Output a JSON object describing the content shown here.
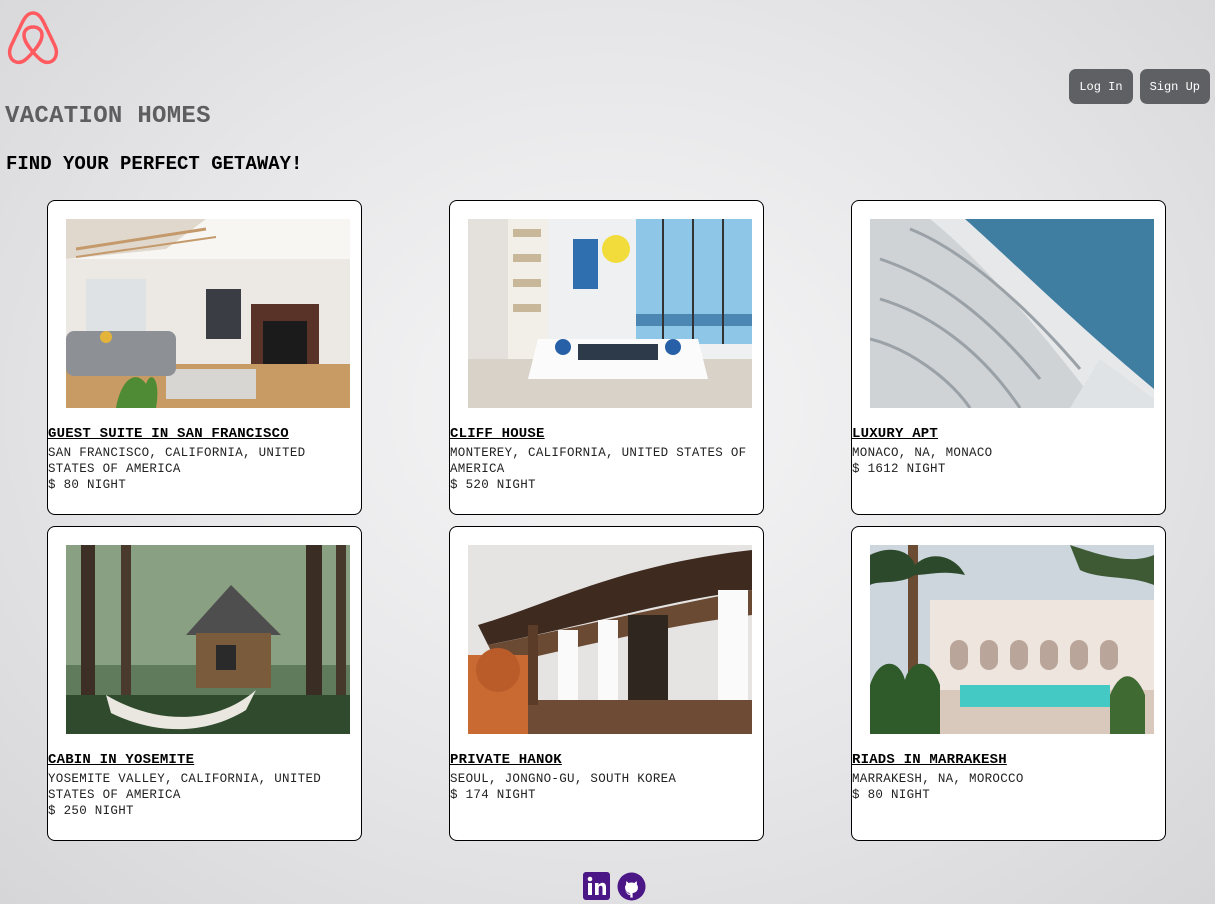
{
  "brand": {
    "logo_icon": "airbnb-logo-icon",
    "color": "#ff5a5f"
  },
  "auth": {
    "login_label": "Log In",
    "signup_label": "Sign Up"
  },
  "site_title": "VACATION HOMES",
  "tagline": "FIND YOUR PERFECT GETAWAY!",
  "listings": [
    {
      "name": "GUEST SUITE IN SAN FRANCISCO",
      "location": "SAN FRANCISCO, CALIFORNIA, UNITED STATES OF AMERICA",
      "price": "$ 80 NIGHT"
    },
    {
      "name": "CLIFF HOUSE",
      "location": "MONTEREY, CALIFORNIA, UNITED STATES OF AMERICA",
      "price": "$ 520 NIGHT"
    },
    {
      "name": "LUXURY APT",
      "location": "MONACO, NA, MONACO",
      "price": "$ 1612 NIGHT"
    },
    {
      "name": "CABIN IN YOSEMITE",
      "location": "YOSEMITE VALLEY, CALIFORNIA, UNITED STATES OF AMERICA",
      "price": "$ 250 NIGHT"
    },
    {
      "name": "PRIVATE HANOK",
      "location": "SEOUL, JONGNO-GU, SOUTH KOREA",
      "price": "$ 174 NIGHT"
    },
    {
      "name": "RIADS IN MARRAKESH",
      "location": "MARRAKESH, NA, MOROCCO",
      "price": "$ 80 NIGHT"
    }
  ],
  "footer": {
    "icons": [
      "linkedin-icon",
      "github-icon"
    ],
    "icon_color": "#4b1686"
  }
}
